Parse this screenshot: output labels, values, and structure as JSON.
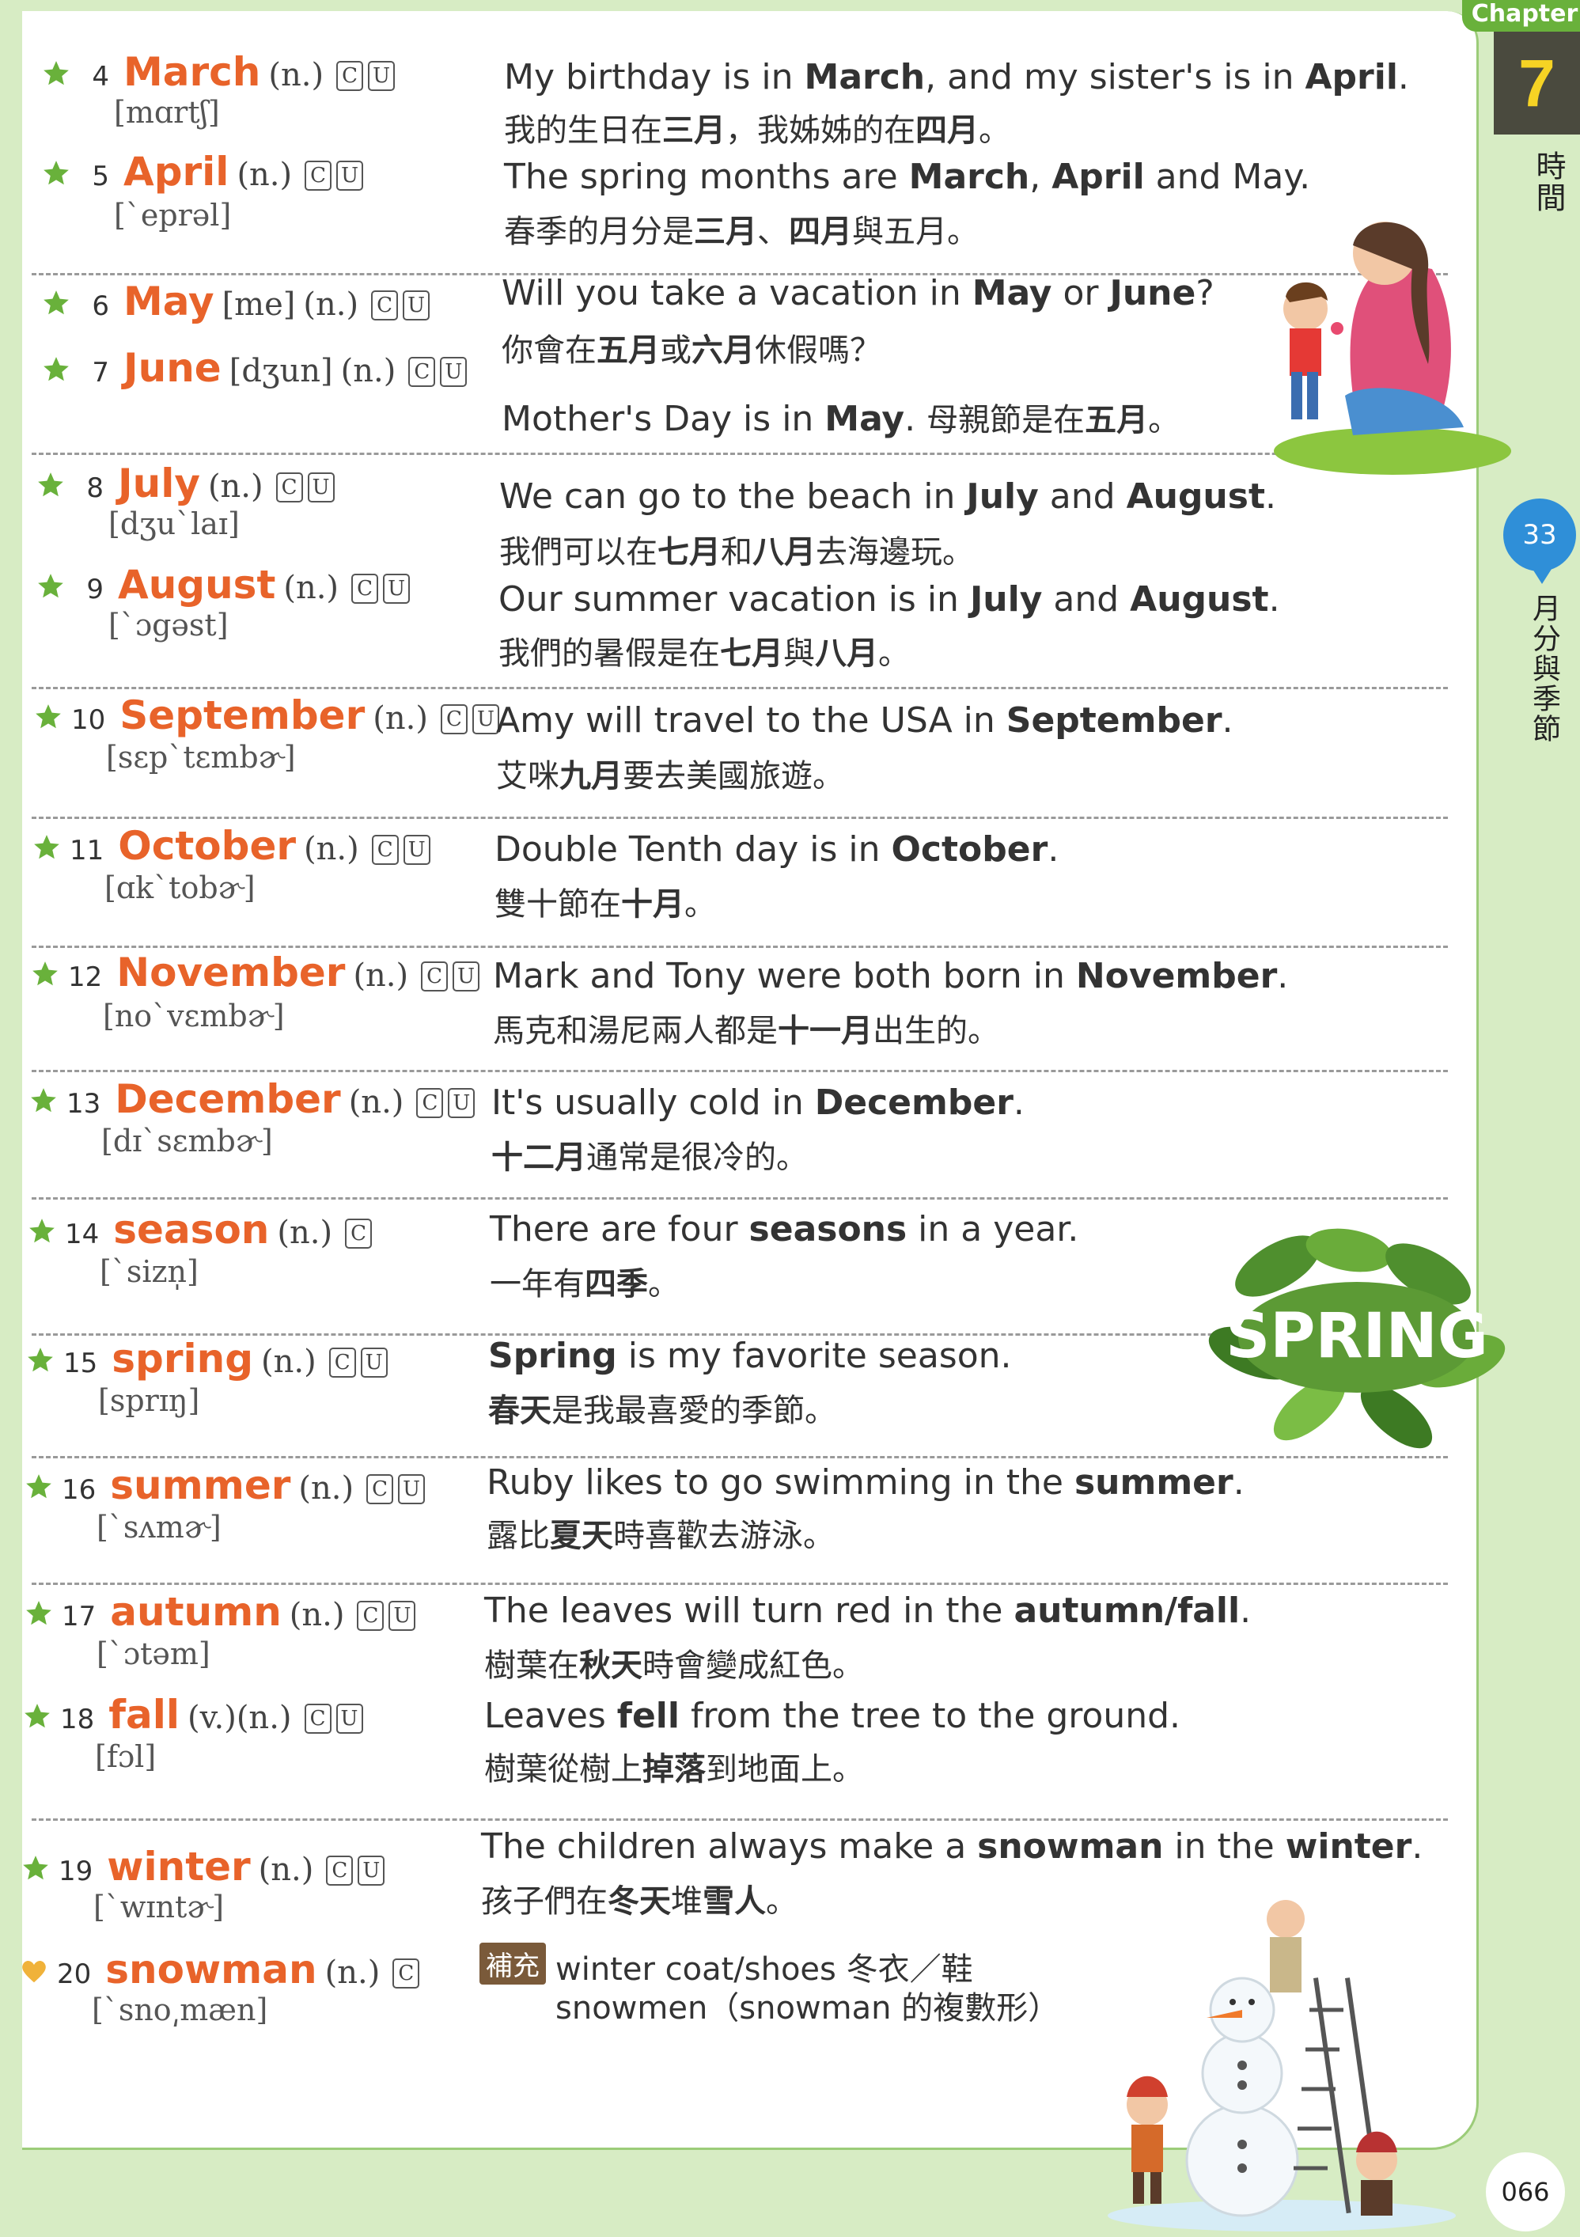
{
  "chapter": {
    "label": "Chapter",
    "number": "7",
    "title": "時間"
  },
  "unit": {
    "number": "33",
    "title": "月分與季節"
  },
  "page_number": "066",
  "illustration": {
    "spring_label": "SPRING"
  },
  "colors": {
    "word": "#e8632a",
    "star": "#69b13b",
    "heart": "#f0b23a",
    "accent": "#69b13b"
  },
  "entries": [
    {
      "num": "4",
      "word": "March",
      "pos": "(n.)",
      "cu": [
        "C",
        "U"
      ],
      "ipa": "[mɑrtʃ]",
      "marker": "star"
    },
    {
      "num": "5",
      "word": "April",
      "pos": "(n.)",
      "cu": [
        "C",
        "U"
      ],
      "ipa": "[ˋeprəl]",
      "marker": "star"
    },
    {
      "num": "6",
      "word": "May",
      "ipa_inline": "[me]",
      "pos": "(n.)",
      "cu": [
        "C",
        "U"
      ],
      "marker": "star"
    },
    {
      "num": "7",
      "word": "June",
      "ipa_inline": "[dʒun]",
      "pos": "(n.)",
      "cu": [
        "C",
        "U"
      ],
      "marker": "star"
    },
    {
      "num": "8",
      "word": "July",
      "pos": "(n.)",
      "cu": [
        "C",
        "U"
      ],
      "ipa": "[dʒuˋlaɪ]",
      "marker": "star"
    },
    {
      "num": "9",
      "word": "August",
      "pos": "(n.)",
      "cu": [
        "C",
        "U"
      ],
      "ipa": "[ˋɔgəst]",
      "marker": "star"
    },
    {
      "num": "10",
      "word": "September",
      "pos": "(n.)",
      "cu": [
        "C",
        "U"
      ],
      "ipa": "[sɛpˋtɛmbɚ]",
      "marker": "star"
    },
    {
      "num": "11",
      "word": "October",
      "pos": "(n.)",
      "cu": [
        "C",
        "U"
      ],
      "ipa": "[ɑkˋtobɚ]",
      "marker": "star"
    },
    {
      "num": "12",
      "word": "November",
      "pos": "(n.)",
      "cu": [
        "C",
        "U"
      ],
      "ipa": "[noˋvɛmbɚ]",
      "marker": "star"
    },
    {
      "num": "13",
      "word": "December",
      "pos": "(n.)",
      "cu": [
        "C",
        "U"
      ],
      "ipa": "[dɪˋsɛmbɚ]",
      "marker": "star"
    },
    {
      "num": "14",
      "word": "season",
      "pos": "(n.)",
      "cu": [
        "C"
      ],
      "ipa": "[ˋsizn̩]",
      "marker": "star"
    },
    {
      "num": "15",
      "word": "spring",
      "pos": "(n.)",
      "cu": [
        "C",
        "U"
      ],
      "ipa": "[sprɪŋ]",
      "marker": "star"
    },
    {
      "num": "16",
      "word": "summer",
      "pos": "(n.)",
      "cu": [
        "C",
        "U"
      ],
      "ipa": "[ˋsʌmɚ]",
      "marker": "star"
    },
    {
      "num": "17",
      "word": "autumn",
      "pos": "(n.)",
      "cu": [
        "C",
        "U"
      ],
      "ipa": "[ˋɔtəm]",
      "marker": "star"
    },
    {
      "num": "18",
      "word": "fall",
      "pos": "(v.)(n.)",
      "cu": [
        "C",
        "U"
      ],
      "ipa": "[fɔl]",
      "marker": "star"
    },
    {
      "num": "19",
      "word": "winter",
      "pos": "(n.)",
      "cu": [
        "C",
        "U"
      ],
      "ipa": "[ˋwɪntɚ]",
      "marker": "star"
    },
    {
      "num": "20",
      "word": "snowman",
      "pos": "(n.)",
      "cu": [
        "C"
      ],
      "ipa": "[ˋsno͵mæn]",
      "marker": "heart"
    }
  ],
  "sentences": [
    {
      "en": [
        "My birthday is in ",
        "March",
        ", and my sister's is in ",
        "April",
        "."
      ],
      "zh": [
        "我的生日在",
        "三月",
        "，我姊姊的在",
        "四月",
        "。"
      ]
    },
    {
      "en": [
        "The spring months are ",
        "March",
        ", ",
        "April",
        " and May."
      ],
      "zh": [
        "春季的月分是",
        "三月",
        "、",
        "四月",
        "與五月。"
      ]
    },
    {
      "en": [
        "Will you take a vacation in ",
        "May",
        " or ",
        "June",
        "?"
      ],
      "zh": [
        "你會在",
        "五月",
        "或",
        "六月",
        "休假嗎？"
      ]
    },
    {
      "en": [
        "Mother's Day is in ",
        "May",
        ". ",
        "",
        ""
      ],
      "zh": [
        "母親節是在",
        "五月",
        "。",
        "",
        ""
      ]
    },
    {
      "en": [
        "We can go to the beach in ",
        "July",
        " and ",
        "August",
        "."
      ],
      "zh": [
        "我們可以在",
        "七月",
        "和",
        "八月",
        "去海邊玩。"
      ]
    },
    {
      "en": [
        "Our summer vacation is in ",
        "July",
        " and ",
        "August",
        "."
      ],
      "zh": [
        "我們的暑假是在",
        "七月",
        "與",
        "八月",
        "。"
      ]
    },
    {
      "en": [
        "Amy will travel to the USA in ",
        "September",
        ".",
        "",
        ""
      ],
      "zh": [
        "艾咪",
        "九月",
        "要去美國旅遊。",
        "",
        ""
      ]
    },
    {
      "en": [
        "Double Tenth day is in ",
        "October",
        ".",
        "",
        ""
      ],
      "zh": [
        "雙十節在",
        "十月",
        "。",
        "",
        ""
      ]
    },
    {
      "en": [
        "Mark and Tony were both born in ",
        "November",
        ".",
        "",
        ""
      ],
      "zh": [
        "馬克和湯尼兩人都是",
        "十一月",
        "出生的。",
        "",
        ""
      ]
    },
    {
      "en": [
        "It's usually cold in ",
        "December",
        ".",
        "",
        ""
      ],
      "zh": [
        "",
        "十二月",
        "通常是很冷的。",
        "",
        ""
      ]
    },
    {
      "en": [
        "There are four ",
        "seasons",
        " in a year.",
        "",
        ""
      ],
      "zh": [
        "一年有",
        "四季",
        "。",
        "",
        ""
      ]
    },
    {
      "en": [
        "",
        "Spring",
        " is my favorite season.",
        "",
        ""
      ],
      "zh": [
        "",
        "春天",
        "是我最喜愛的季節。",
        "",
        ""
      ]
    },
    {
      "en": [
        "Ruby likes to go swimming in the ",
        "summer",
        ".",
        "",
        ""
      ],
      "zh": [
        "露比",
        "夏天",
        "時喜歡去游泳。",
        "",
        ""
      ]
    },
    {
      "en": [
        "The leaves will turn red in the ",
        "autumn/fall",
        ".",
        "",
        ""
      ],
      "zh": [
        "樹葉在",
        "秋天",
        "時會變成紅色。",
        "",
        ""
      ]
    },
    {
      "en": [
        "Leaves ",
        "fell",
        " from the tree to the ground.",
        "",
        ""
      ],
      "zh": [
        "樹葉從樹上",
        "掉落",
        "到地面上。",
        "",
        ""
      ]
    },
    {
      "en": [
        "The children always make a ",
        "snowman",
        " in the ",
        "winter",
        "."
      ],
      "zh": [
        "孩子們在",
        "冬天",
        "堆",
        "雪人",
        "。"
      ]
    }
  ],
  "supplement": {
    "tag": "補充",
    "line1": "winter coat/shoes 冬衣／鞋",
    "line2": "snowmen（snowman 的複數形）"
  }
}
